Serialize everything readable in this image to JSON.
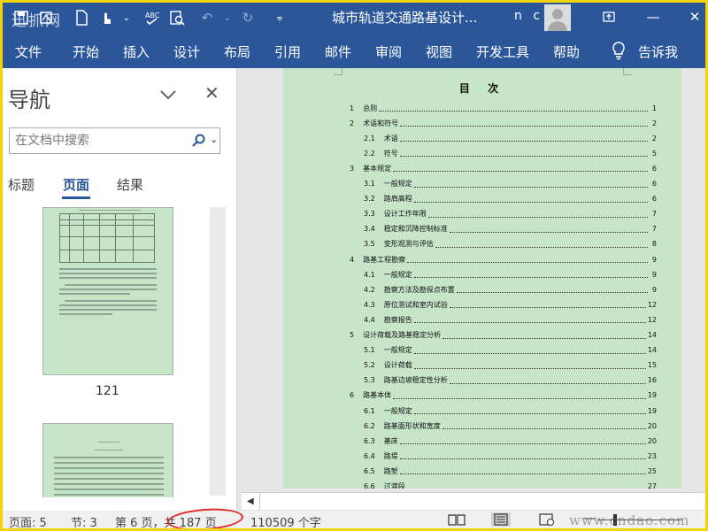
{
  "window": {
    "title": "城市轨道交通路基设计...",
    "user": "n c",
    "watermark": "迅抓网"
  },
  "ribbon": {
    "tabs": [
      "文件",
      "开始",
      "插入",
      "设计",
      "布局",
      "引用",
      "邮件",
      "审阅",
      "视图",
      "开发工具",
      "帮助"
    ],
    "tell_me": "告诉我"
  },
  "nav": {
    "title": "导航",
    "search_placeholder": "在文档中搜索",
    "tabs": [
      "标题",
      "页面",
      "结果"
    ],
    "active_tab": "页面",
    "thumbnails": [
      {
        "page_label": "121"
      },
      {
        "page_label": ""
      }
    ]
  },
  "document": {
    "toc_title": "目 次",
    "toc": [
      {
        "num": "1",
        "text": "总则",
        "page": "1",
        "level": 1
      },
      {
        "num": "2",
        "text": "术语和符号",
        "page": "2",
        "level": 1
      },
      {
        "num": "2.1",
        "text": "术语",
        "page": "2",
        "level": 2
      },
      {
        "num": "2.2",
        "text": "符号",
        "page": "5",
        "level": 2
      },
      {
        "num": "3",
        "text": "基本规定",
        "page": "6",
        "level": 1
      },
      {
        "num": "3.1",
        "text": "一般规定",
        "page": "6",
        "level": 2
      },
      {
        "num": "3.2",
        "text": "路肩高程",
        "page": "6",
        "level": 2
      },
      {
        "num": "3.3",
        "text": "设计工作年限",
        "page": "7",
        "level": 2
      },
      {
        "num": "3.4",
        "text": "稳定和沉降控制标准",
        "page": "7",
        "level": 2
      },
      {
        "num": "3.5",
        "text": "变形观测与评估",
        "page": "8",
        "level": 2
      },
      {
        "num": "4",
        "text": "路基工程勘察",
        "page": "9",
        "level": 1
      },
      {
        "num": "4.1",
        "text": "一般规定",
        "page": "9",
        "level": 2
      },
      {
        "num": "4.2",
        "text": "勘察方法及勘探点布置",
        "page": "9",
        "level": 2
      },
      {
        "num": "4.3",
        "text": "原位测试和室内试验",
        "page": "12",
        "level": 2
      },
      {
        "num": "4.4",
        "text": "勘察报告",
        "page": "12",
        "level": 2
      },
      {
        "num": "5",
        "text": "设计荷载及路基稳定分析",
        "page": "14",
        "level": 1
      },
      {
        "num": "5.1",
        "text": "一般规定",
        "page": "14",
        "level": 2
      },
      {
        "num": "5.2",
        "text": "设计荷载",
        "page": "15",
        "level": 2
      },
      {
        "num": "5.3",
        "text": "路基边坡稳定性分析",
        "page": "16",
        "level": 2
      },
      {
        "num": "6",
        "text": "路基本体",
        "page": "19",
        "level": 1
      },
      {
        "num": "6.1",
        "text": "一般规定",
        "page": "19",
        "level": 2
      },
      {
        "num": "6.2",
        "text": "路基面形状和宽度",
        "page": "20",
        "level": 2
      },
      {
        "num": "6.3",
        "text": "基床",
        "page": "20",
        "level": 2
      },
      {
        "num": "6.4",
        "text": "路堤",
        "page": "23",
        "level": 2
      },
      {
        "num": "6.5",
        "text": "路堑",
        "page": "25",
        "level": 2
      },
      {
        "num": "6.6",
        "text": "过渡段",
        "page": "27",
        "level": 2
      }
    ]
  },
  "status": {
    "page": "页面: 5",
    "section": "节: 3",
    "page_of": "第 6 页，共 187 页",
    "words": "110509 个字",
    "site_watermark": "www.cndao.com"
  },
  "colors": {
    "ribbon": "#2b579a",
    "page_background": "#c6e5c9",
    "highlight_oval": "#e0262a",
    "outer_frame": "#f3d400"
  },
  "icons": [
    "save-icon",
    "new-document-icon",
    "touch-mode-icon",
    "spelling-icon",
    "search-preview-icon",
    "undo-icon",
    "redo-icon",
    "customize-qat-icon",
    "restore-icon",
    "minimize-icon",
    "maximize-icon",
    "close-icon",
    "lightbulb-icon",
    "search-icon",
    "read-mode-icon",
    "print-layout-icon",
    "web-layout-icon"
  ]
}
